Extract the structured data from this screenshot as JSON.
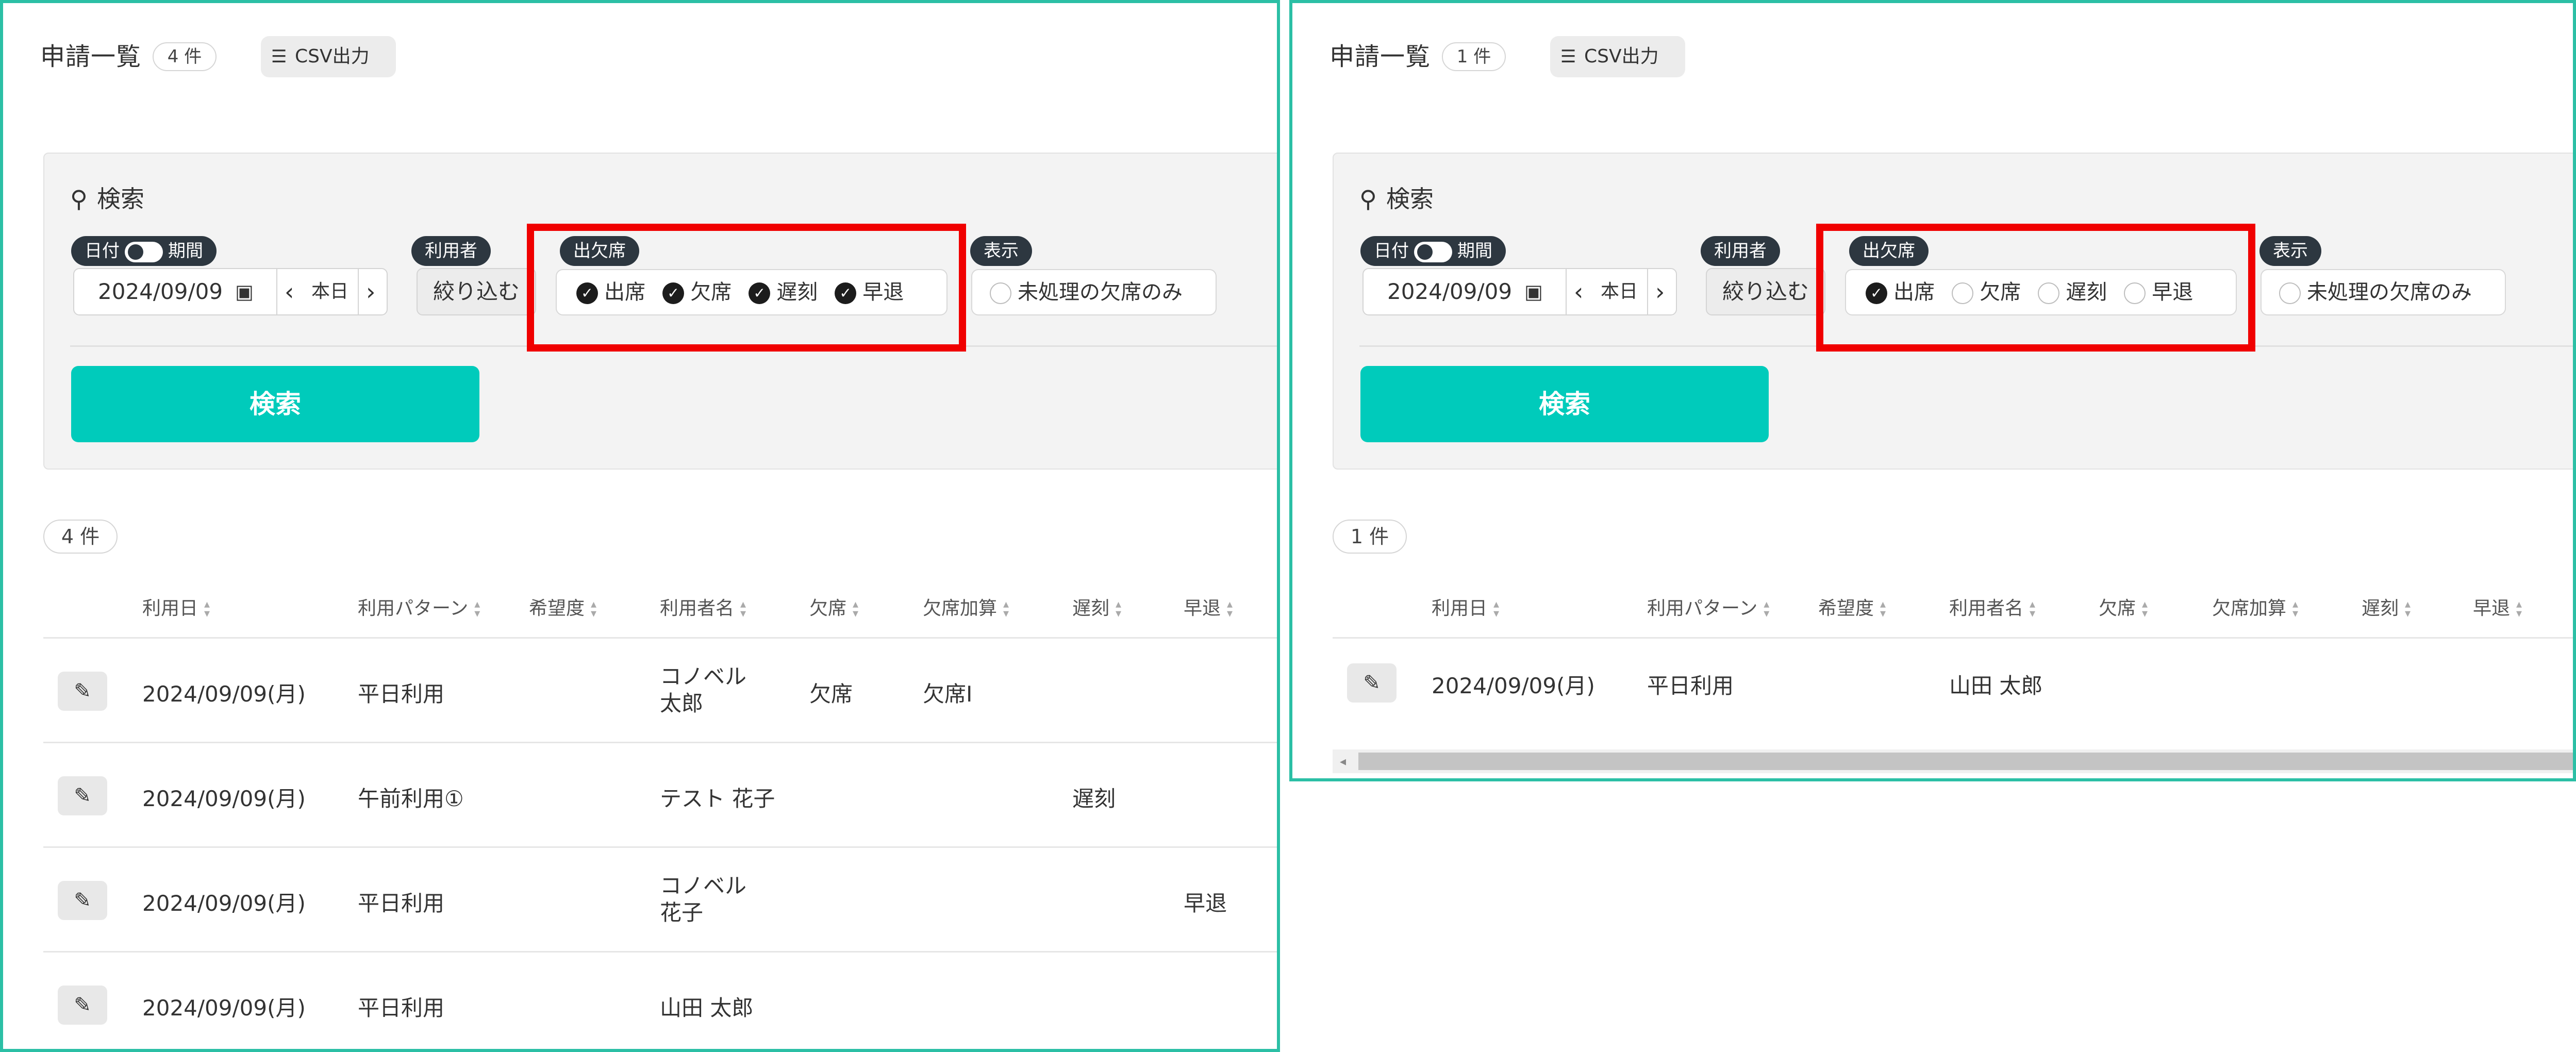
{
  "left": {
    "header": {
      "title": "申請一覧",
      "count": "4 件",
      "csv_label": "CSV出力"
    },
    "search": {
      "title": "検索",
      "date_tag": "日付",
      "period_tag": "期間",
      "date_value": "2024/09/09",
      "today_label": "本日",
      "user_tag": "利用者",
      "narrow_label": "絞り込む",
      "attendance_tag": "出欠席",
      "attendance_options": [
        {
          "label": "出席",
          "checked": true
        },
        {
          "label": "欠席",
          "checked": true
        },
        {
          "label": "遅刻",
          "checked": true
        },
        {
          "label": "早退",
          "checked": true
        }
      ],
      "display_tag": "表示",
      "display_option": "未処理の欠席のみ",
      "search_button": "検索"
    },
    "result_count": "4 件",
    "columns": [
      "利用日",
      "利用パターン",
      "希望度",
      "利用者名",
      "欠席",
      "欠席加算",
      "遅刻",
      "早退"
    ],
    "rows": [
      {
        "date": "2024/09/09(月)",
        "pattern": "平日利用",
        "hope": "",
        "name": "コノベル 太郎",
        "absence": "欠席",
        "absence_add": "欠席Ⅰ",
        "late": "",
        "early": ""
      },
      {
        "date": "2024/09/09(月)",
        "pattern": "午前利用①",
        "hope": "",
        "name": "テスト 花子",
        "absence": "",
        "absence_add": "",
        "late": "遅刻",
        "early": ""
      },
      {
        "date": "2024/09/09(月)",
        "pattern": "平日利用",
        "hope": "",
        "name": "コノベル 花子",
        "absence": "",
        "absence_add": "",
        "late": "",
        "early": "早退"
      },
      {
        "date": "2024/09/09(月)",
        "pattern": "平日利用",
        "hope": "",
        "name": "山田 太郎",
        "absence": "",
        "absence_add": "",
        "late": "",
        "early": ""
      }
    ]
  },
  "right": {
    "header": {
      "title": "申請一覧",
      "count": "1 件",
      "csv_label": "CSV出力"
    },
    "search": {
      "title": "検索",
      "date_tag": "日付",
      "period_tag": "期間",
      "date_value": "2024/09/09",
      "today_label": "本日",
      "user_tag": "利用者",
      "narrow_label": "絞り込む",
      "attendance_tag": "出欠席",
      "attendance_options": [
        {
          "label": "出席",
          "checked": true
        },
        {
          "label": "欠席",
          "checked": false
        },
        {
          "label": "遅刻",
          "checked": false
        },
        {
          "label": "早退",
          "checked": false
        }
      ],
      "display_tag": "表示",
      "display_option": "未処理の欠席のみ",
      "search_button": "検索"
    },
    "result_count": "1 件",
    "columns": [
      "利用日",
      "利用パターン",
      "希望度",
      "利用者名",
      "欠席",
      "欠席加算",
      "遅刻",
      "早退"
    ],
    "rows": [
      {
        "date": "2024/09/09(月)",
        "pattern": "平日利用",
        "hope": "",
        "name": "山田 太郎",
        "absence": "",
        "absence_add": "",
        "late": "",
        "early": ""
      }
    ]
  },
  "colors": {
    "accent": "#00cbbb",
    "border": "#2bbfa5",
    "highlight": "#f00000",
    "tag_bg": "#2d3740"
  },
  "icons": {
    "csv": "list-icon",
    "search": "magnifier-icon",
    "calendar": "calendar-icon",
    "edit": "edit-icon",
    "check": "check-circle-icon"
  }
}
